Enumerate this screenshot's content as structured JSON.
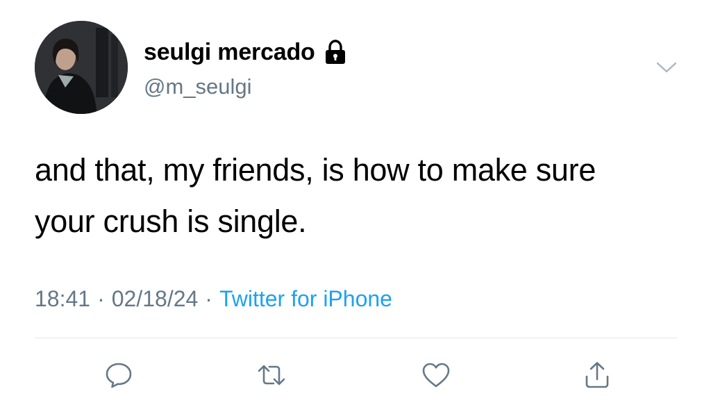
{
  "user": {
    "display_name": "seulgi mercado",
    "handle": "@m_seulgi",
    "protected": true,
    "avatar_icon": "profile-photo"
  },
  "tweet": {
    "text": "and that, my friends, is how to make sure your crush is single."
  },
  "meta": {
    "time": "18:41",
    "date": "02/18/24",
    "separator": "·",
    "source": "Twitter for iPhone"
  },
  "actions": [
    {
      "name": "reply",
      "icon": "speech-bubble-icon"
    },
    {
      "name": "retweet",
      "icon": "retweet-arrows-icon"
    },
    {
      "name": "like",
      "icon": "heart-icon"
    },
    {
      "name": "share",
      "icon": "share-upload-icon"
    }
  ],
  "colors": {
    "text_primary": "#000000",
    "text_secondary": "#657786",
    "link": "#1da1f2",
    "divider": "#e1e8ed",
    "icon": "#657786"
  }
}
